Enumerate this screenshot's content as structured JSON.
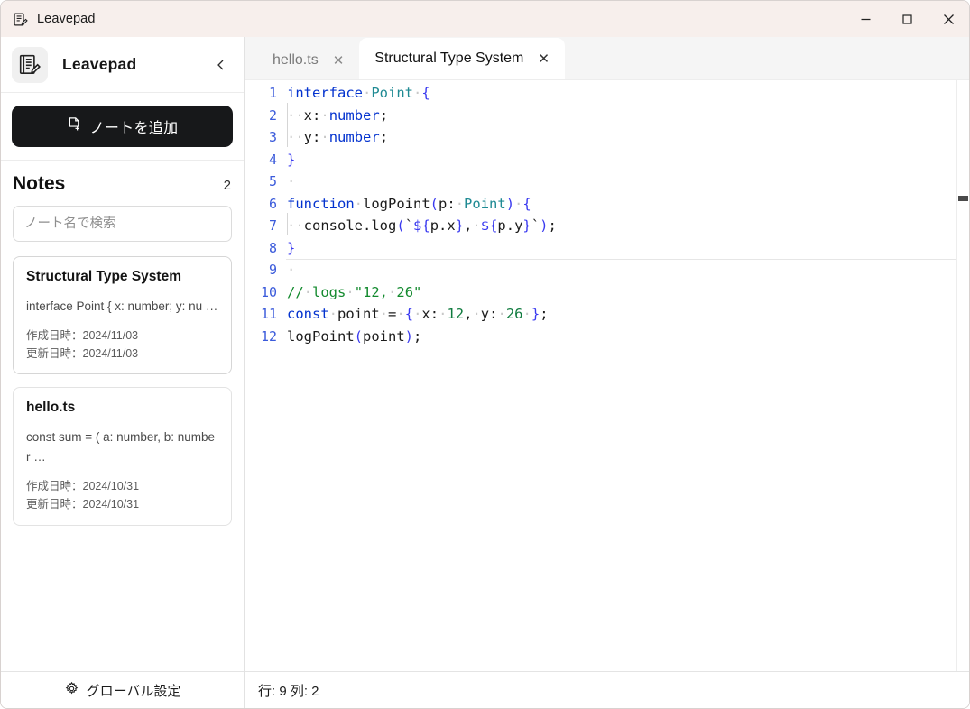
{
  "window": {
    "title": "Leavepad",
    "icon": "notepad-pencil-icon",
    "controls": {
      "minimize": "–",
      "maximize": "□",
      "close": "✕"
    }
  },
  "sidebar": {
    "app_name": "Leavepad",
    "collapse_label": "‹",
    "add_note_label": "ノートを追加",
    "notes_heading": "Notes",
    "notes_count": "2",
    "search_placeholder": "ノート名で検索",
    "search_value": "",
    "notes": [
      {
        "title": "Structural Type System",
        "preview": "interface Point { x: number; y: nu …",
        "created": "作成日時：2024/11/03",
        "updated": "更新日時：2024/11/03",
        "selected": true
      },
      {
        "title": "hello.ts",
        "preview": "const sum = ( a: number, b: number …",
        "created": "作成日時：2024/10/31",
        "updated": "更新日時：2024/10/31",
        "selected": false
      }
    ],
    "footer_label": "グローバル設定",
    "footer_icon": "gear-icon"
  },
  "tabs": [
    {
      "label": "hello.ts",
      "active": false,
      "close": "✕"
    },
    {
      "label": "Structural Type System",
      "active": true,
      "close": "✕"
    }
  ],
  "editor": {
    "language": "typescript",
    "current_line": 9,
    "lines": [
      {
        "n": "1",
        "text": "interface Point {"
      },
      {
        "n": "2",
        "text": "  x: number;"
      },
      {
        "n": "3",
        "text": "  y: number;"
      },
      {
        "n": "4",
        "text": "}"
      },
      {
        "n": "5",
        "text": ""
      },
      {
        "n": "6",
        "text": "function logPoint(p: Point) {"
      },
      {
        "n": "7",
        "text": "  console.log(`${p.x}, ${p.y}`);"
      },
      {
        "n": "8",
        "text": "}"
      },
      {
        "n": "9",
        "text": ""
      },
      {
        "n": "10",
        "text": "// logs \"12, 26\""
      },
      {
        "n": "11",
        "text": "const point = { x: 12, y: 26 };"
      },
      {
        "n": "12",
        "text": "logPoint(point);"
      }
    ]
  },
  "statusbar": {
    "position": "行: 9  列: 2"
  },
  "colors": {
    "titlebar_bg": "#f7efec",
    "accent_dark": "#17181a",
    "keyword": "#0433cf",
    "type": "#1f8a93",
    "number": "#0f7b3e",
    "comment": "#138a2e",
    "linenumber": "#3b5bdb"
  }
}
